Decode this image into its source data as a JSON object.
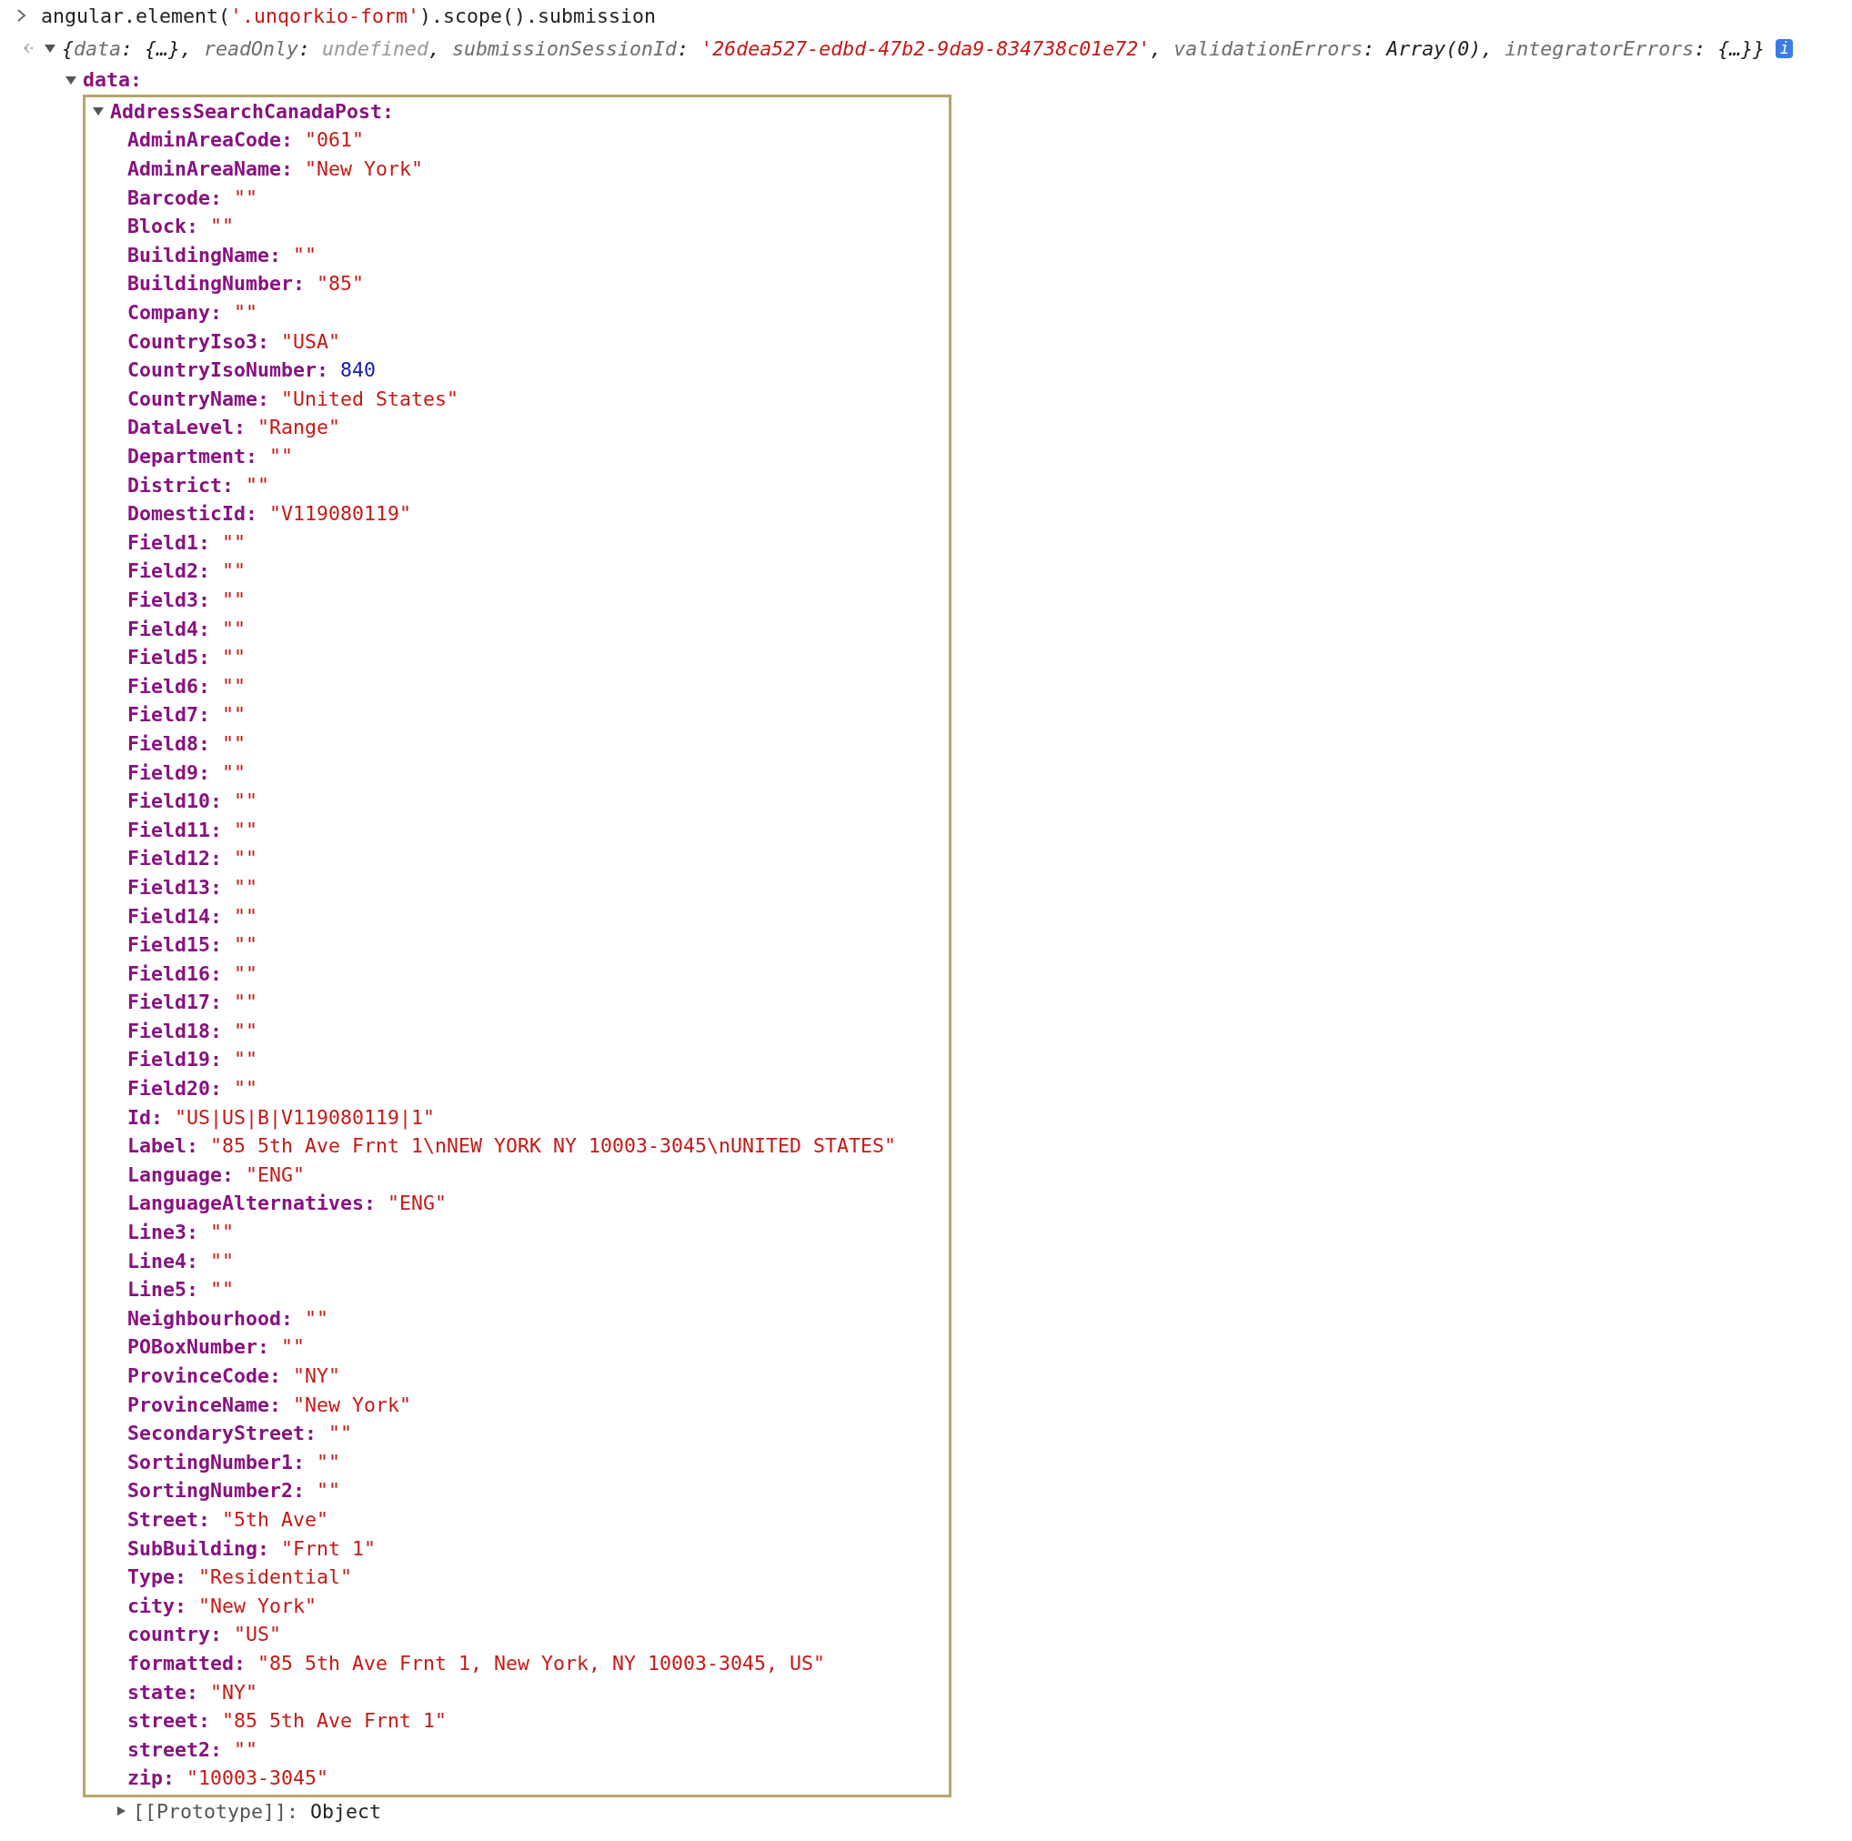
{
  "command": {
    "parts": [
      {
        "kind": "plain",
        "text": "angular.element("
      },
      {
        "kind": "string",
        "text": "'.unqorkio-form'"
      },
      {
        "kind": "plain",
        "text": ").scope().submission"
      }
    ]
  },
  "result": {
    "expanded": true,
    "info": "i",
    "parts": [
      {
        "kind": "plain",
        "text": "{"
      },
      {
        "kind": "key",
        "text": "data"
      },
      {
        "kind": "plain",
        "text": ": {…}, "
      },
      {
        "kind": "key",
        "text": "readOnly"
      },
      {
        "kind": "plain",
        "text": ": "
      },
      {
        "kind": "undefined",
        "text": "undefined"
      },
      {
        "kind": "plain",
        "text": ", "
      },
      {
        "kind": "key",
        "text": "submissionSessionId"
      },
      {
        "kind": "plain",
        "text": ": "
      },
      {
        "kind": "string",
        "text": "'26dea527-edbd-47b2-9da9-834738c01e72'"
      },
      {
        "kind": "plain",
        "text": ", "
      },
      {
        "kind": "key",
        "text": "validationErrors"
      },
      {
        "kind": "plain",
        "text": ": Array(0), "
      },
      {
        "kind": "key",
        "text": "integratorErrors"
      },
      {
        "kind": "plain",
        "text": ": {…}}"
      }
    ]
  },
  "data": {
    "key": "data:",
    "expanded": true,
    "children": [
      {
        "key": "AddressSearchCanadaPost:",
        "expanded": true,
        "highlighted": true,
        "properties": [
          {
            "key": "AdminAreaCode:",
            "kind": "string",
            "value": "\"061\""
          },
          {
            "key": "AdminAreaName:",
            "kind": "string",
            "value": "\"New York\""
          },
          {
            "key": "Barcode:",
            "kind": "string",
            "value": "\"\""
          },
          {
            "key": "Block:",
            "kind": "string",
            "value": "\"\""
          },
          {
            "key": "BuildingName:",
            "kind": "string",
            "value": "\"\""
          },
          {
            "key": "BuildingNumber:",
            "kind": "string",
            "value": "\"85\""
          },
          {
            "key": "Company:",
            "kind": "string",
            "value": "\"\""
          },
          {
            "key": "CountryIso3:",
            "kind": "string",
            "value": "\"USA\""
          },
          {
            "key": "CountryIsoNumber:",
            "kind": "number",
            "value": "840"
          },
          {
            "key": "CountryName:",
            "kind": "string",
            "value": "\"United States\""
          },
          {
            "key": "DataLevel:",
            "kind": "string",
            "value": "\"Range\""
          },
          {
            "key": "Department:",
            "kind": "string",
            "value": "\"\""
          },
          {
            "key": "District:",
            "kind": "string",
            "value": "\"\""
          },
          {
            "key": "DomesticId:",
            "kind": "string",
            "value": "\"V119080119\""
          },
          {
            "key": "Field1:",
            "kind": "string",
            "value": "\"\""
          },
          {
            "key": "Field2:",
            "kind": "string",
            "value": "\"\""
          },
          {
            "key": "Field3:",
            "kind": "string",
            "value": "\"\""
          },
          {
            "key": "Field4:",
            "kind": "string",
            "value": "\"\""
          },
          {
            "key": "Field5:",
            "kind": "string",
            "value": "\"\""
          },
          {
            "key": "Field6:",
            "kind": "string",
            "value": "\"\""
          },
          {
            "key": "Field7:",
            "kind": "string",
            "value": "\"\""
          },
          {
            "key": "Field8:",
            "kind": "string",
            "value": "\"\""
          },
          {
            "key": "Field9:",
            "kind": "string",
            "value": "\"\""
          },
          {
            "key": "Field10:",
            "kind": "string",
            "value": "\"\""
          },
          {
            "key": "Field11:",
            "kind": "string",
            "value": "\"\""
          },
          {
            "key": "Field12:",
            "kind": "string",
            "value": "\"\""
          },
          {
            "key": "Field13:",
            "kind": "string",
            "value": "\"\""
          },
          {
            "key": "Field14:",
            "kind": "string",
            "value": "\"\""
          },
          {
            "key": "Field15:",
            "kind": "string",
            "value": "\"\""
          },
          {
            "key": "Field16:",
            "kind": "string",
            "value": "\"\""
          },
          {
            "key": "Field17:",
            "kind": "string",
            "value": "\"\""
          },
          {
            "key": "Field18:",
            "kind": "string",
            "value": "\"\""
          },
          {
            "key": "Field19:",
            "kind": "string",
            "value": "\"\""
          },
          {
            "key": "Field20:",
            "kind": "string",
            "value": "\"\""
          },
          {
            "key": "Id:",
            "kind": "string",
            "value": "\"US|US|B|V119080119|1\""
          },
          {
            "key": "Label:",
            "kind": "string",
            "value": "\"85 5th Ave Frnt 1\\nNEW YORK NY 10003-3045\\nUNITED STATES\""
          },
          {
            "key": "Language:",
            "kind": "string",
            "value": "\"ENG\""
          },
          {
            "key": "LanguageAlternatives:",
            "kind": "string",
            "value": "\"ENG\""
          },
          {
            "key": "Line3:",
            "kind": "string",
            "value": "\"\""
          },
          {
            "key": "Line4:",
            "kind": "string",
            "value": "\"\""
          },
          {
            "key": "Line5:",
            "kind": "string",
            "value": "\"\""
          },
          {
            "key": "Neighbourhood:",
            "kind": "string",
            "value": "\"\""
          },
          {
            "key": "POBoxNumber:",
            "kind": "string",
            "value": "\"\""
          },
          {
            "key": "ProvinceCode:",
            "kind": "string",
            "value": "\"NY\""
          },
          {
            "key": "ProvinceName:",
            "kind": "string",
            "value": "\"New York\""
          },
          {
            "key": "SecondaryStreet:",
            "kind": "string",
            "value": "\"\""
          },
          {
            "key": "SortingNumber1:",
            "kind": "string",
            "value": "\"\""
          },
          {
            "key": "SortingNumber2:",
            "kind": "string",
            "value": "\"\""
          },
          {
            "key": "Street:",
            "kind": "string",
            "value": "\"5th Ave\""
          },
          {
            "key": "SubBuilding:",
            "kind": "string",
            "value": "\"Frnt 1\""
          },
          {
            "key": "Type:",
            "kind": "string",
            "value": "\"Residential\""
          },
          {
            "key": "city:",
            "kind": "string",
            "value": "\"New York\""
          },
          {
            "key": "country:",
            "kind": "string",
            "value": "\"US\""
          },
          {
            "key": "formatted:",
            "kind": "string",
            "value": "\"85 5th Ave Frnt 1, New York, NY 10003-3045, US\""
          },
          {
            "key": "state:",
            "kind": "string",
            "value": "\"NY\""
          },
          {
            "key": "street:",
            "kind": "string",
            "value": "\"85 5th Ave Frnt 1\""
          },
          {
            "key": "street2:",
            "kind": "string",
            "value": "\"\""
          },
          {
            "key": "zip:",
            "kind": "string",
            "value": "\"10003-3045\""
          }
        ],
        "prototype": {
          "key": "[[Prototype]]:",
          "value": "Object",
          "expanded": false
        }
      }
    ]
  }
}
